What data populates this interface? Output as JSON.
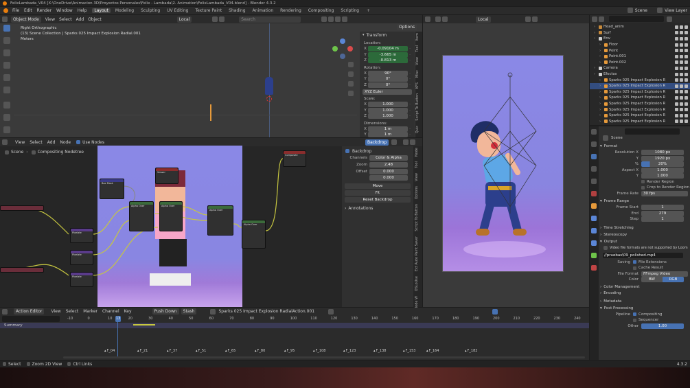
{
  "window_title": "FelixLambada_V04 [X:\\OneDrive\\Animacion 3D\\Proyectos Personales\\Felix - Lambada\\2. Animation\\FelixLambada_V04.blend] - Blender 4.3.2",
  "menu": [
    "File",
    "Edit",
    "Render",
    "Window",
    "Help"
  ],
  "workspaces": [
    "Layout",
    "Modeling",
    "Sculpting",
    "UV Editing",
    "Texture Paint",
    "Shading",
    "Animation",
    "Rendering",
    "Compositing",
    "Scripting"
  ],
  "active_workspace": "Layout",
  "scene_name": "Scene",
  "view_layer": "View Layer",
  "viewport": {
    "mode": "Object Mode",
    "menus": [
      "View",
      "Select",
      "Add",
      "Object"
    ],
    "transform_orientation": "Local",
    "search_placeholder": "Search",
    "view_name": "Right Orthographic",
    "collection_info": "(13) Scene Collection | Sparks 025 Impact Explosion Radial.001",
    "units": "Meters",
    "options_label": "Options"
  },
  "n_panel": {
    "title": "Transform",
    "location_label": "Location:",
    "location": [
      {
        "axis": "X",
        "value": "-0.09104 m"
      },
      {
        "axis": "Y",
        "value": "-3.665 m"
      },
      {
        "axis": "Z",
        "value": "-0.813 m"
      }
    ],
    "rotation_label": "Rotation:",
    "rotation": [
      {
        "axis": "X",
        "value": "90°"
      },
      {
        "axis": "Y",
        "value": "0°"
      },
      {
        "axis": "Z",
        "value": "0°"
      }
    ],
    "rotation_mode": "XYZ Euler",
    "scale_label": "Scale:",
    "scale": [
      {
        "axis": "X",
        "value": "1.000"
      },
      {
        "axis": "Y",
        "value": "1.000"
      },
      {
        "axis": "Z",
        "value": "1.000"
      }
    ],
    "dimensions_label": "Dimensions:",
    "dimensions": [
      {
        "axis": "X",
        "value": "1 m"
      },
      {
        "axis": "Y",
        "value": "1 m"
      }
    ],
    "tabs": [
      "Item",
      "Tool",
      "View",
      "Misc",
      "KFS",
      "Script To Button",
      "Quic"
    ]
  },
  "compositor": {
    "menus": [
      "View",
      "Select",
      "Add",
      "Node"
    ],
    "use_nodes_label": "Use Nodes",
    "backdrop_button": "Backdrop",
    "breadcrumb": [
      "Scene",
      "Compositing Nodetree"
    ],
    "panel": {
      "backdrop_label": "Backdrop",
      "channels_label": "Channels",
      "channels_value": "Color & Alpha",
      "zoom_label": "Zoom",
      "zoom_value": "2.48",
      "offset_label": "Offset",
      "offset_x": "0.000",
      "offset_y": "0.000",
      "move_btn": "Move",
      "fit_btn": "Fit",
      "reset_btn": "Reset Backdrop",
      "annotations_label": "Annotations"
    },
    "side_tabs": [
      "Node",
      "Tool",
      "View",
      "Options",
      "Script To Button",
      "Ext Auto Paint Saver",
      "OSLoUse",
      "Node W"
    ],
    "nodes": [
      {
        "title": "Composite"
      },
      {
        "title": "Viewer"
      },
      {
        "title": "Alpha Over"
      },
      {
        "title": "Alpha Over"
      },
      {
        "title": "Alpha Over"
      },
      {
        "title": "Alpha Over"
      },
      {
        "title": "Box Mask"
      },
      {
        "title": "Pixelate"
      },
      {
        "title": "Pixelate"
      },
      {
        "title": "Pixelate"
      }
    ]
  },
  "dopesheet": {
    "editor": "Action Editor",
    "menus": [
      "View",
      "Select",
      "Marker",
      "Channel",
      "Key"
    ],
    "push_down": "Push Down",
    "stash": "Stash",
    "action_name": "Sparks 025 Impact Explosion RadialAction.001",
    "summary": "Summary",
    "current_frame": "13",
    "ruler": [
      "-10",
      "0",
      "10",
      "20",
      "30",
      "40",
      "50",
      "60",
      "70",
      "80",
      "90",
      "100",
      "110",
      "120",
      "130",
      "140",
      "150",
      "160",
      "170",
      "180",
      "190",
      "200",
      "210",
      "220",
      "230",
      "240"
    ],
    "markers": [
      "F_04",
      "F_21",
      "F_37",
      "F_51",
      "F_65",
      "F_80",
      "F_95",
      "F_108",
      "F_123",
      "F_138",
      "F_153",
      "F_164",
      "F_182"
    ]
  },
  "outliner": {
    "search_placeholder": "",
    "items": [
      {
        "name": "Head_anim",
        "indent": 0,
        "color": "#c88a3a"
      },
      {
        "name": "Surf",
        "indent": 0,
        "color": "#c88a3a"
      },
      {
        "name": "Env",
        "indent": 0,
        "color": "#cfcfcf"
      },
      {
        "name": "Floor",
        "indent": 1,
        "color": "#e69a3b"
      },
      {
        "name": "Point",
        "indent": 1,
        "color": "#e69a3b"
      },
      {
        "name": "Point.001",
        "indent": 1,
        "color": "#e69a3b"
      },
      {
        "name": "Point.002",
        "indent": 1,
        "color": "#e69a3b"
      },
      {
        "name": "Camera",
        "indent": 0,
        "color": "#cfcfcf"
      },
      {
        "name": "Efectos",
        "indent": 0,
        "color": "#cfcfcf"
      },
      {
        "name": "Sparks 025 Impact Explosion Ra",
        "indent": 1,
        "color": "#e69a3b"
      },
      {
        "name": "Sparks 025 Impact Explosion Ra",
        "indent": 1,
        "color": "#e69a3b",
        "selected": true
      },
      {
        "name": "Sparks 025 Impact Explosion Ra",
        "indent": 1,
        "color": "#e69a3b"
      },
      {
        "name": "Sparks 025 Impact Explosion Ra",
        "indent": 1,
        "color": "#e69a3b"
      },
      {
        "name": "Sparks 025 Impact Explosion Ra",
        "indent": 1,
        "color": "#e69a3b"
      },
      {
        "name": "Sparks 025 Impact Explosion Ra",
        "indent": 1,
        "color": "#e69a3b"
      },
      {
        "name": "Sparks 025 Impact Explosion Ra",
        "indent": 1,
        "color": "#e69a3b"
      },
      {
        "name": "Sparks 025 Impact Explosion Ra",
        "indent": 1,
        "color": "#e69a3b"
      }
    ]
  },
  "properties": {
    "scene_label": "Scene",
    "format_label": "Format",
    "res_x_label": "Resolution X",
    "res_x": "1080 px",
    "res_y_label": "Y",
    "res_y": "1920 px",
    "res_pct_label": "%",
    "res_pct": "20%",
    "aspect_x_label": "Aspect X",
    "aspect_x": "1.000",
    "aspect_y_label": "Y",
    "aspect_y": "1.000",
    "render_region": "Render Region",
    "crop_region": "Crop to Render Region",
    "frame_rate_label": "Frame Rate",
    "frame_rate": "30 fps",
    "frame_range_label": "Frame Range",
    "frame_start_label": "Frame Start",
    "frame_start": "1",
    "end_label": "End",
    "end": "279",
    "step_label": "Step",
    "step": "1",
    "time_stretching": "Time Stretching",
    "stereoscopy": "Stereoscopy",
    "output_label": "Output",
    "output_warning": "Video file formats are not supported by Loom",
    "output_path": "//pruebas\\09_polished.mp4",
    "saving_label": "Saving",
    "file_extensions": "File Extensions",
    "cache_result": "Cache Result",
    "file_format_label": "File Format",
    "file_format": "FFmpeg Video",
    "color_label": "Color",
    "color_bw": "BW",
    "color_rgb": "RGB",
    "color_management": "Color Management",
    "encoding": "Encoding",
    "metadata": "Metadata",
    "post_processing": "Post Processing",
    "pipeline_label": "Pipeline",
    "compositing": "Compositing",
    "sequencer": "Sequencer",
    "other_label": "Other",
    "other_value": "1.00"
  },
  "status_bar": {
    "items": [
      "Select",
      "Zoom 2D View",
      "Ctrl Links"
    ],
    "version": "4.3.2"
  }
}
